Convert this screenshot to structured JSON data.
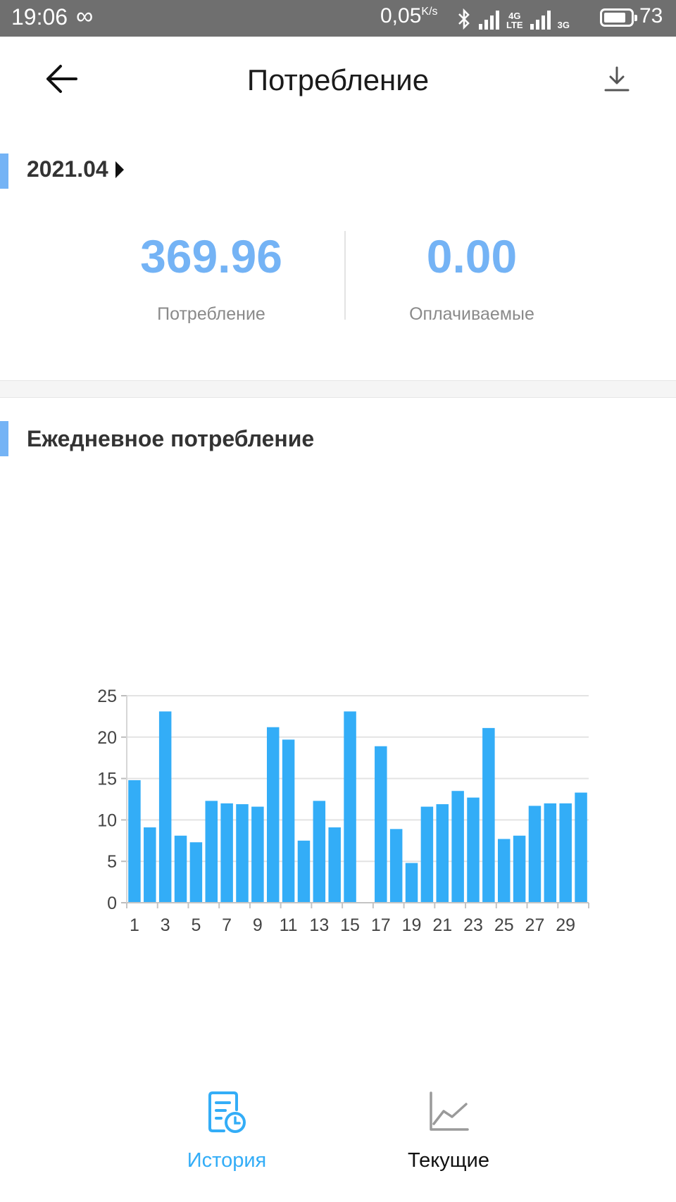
{
  "status_bar": {
    "time": "19:06",
    "speed": "0,05",
    "speed_unit": "K/s",
    "network_1": "4G",
    "network_1_sub": "LTE",
    "network_2": "3G",
    "battery": "73"
  },
  "header": {
    "title": "Потребление"
  },
  "summary": {
    "period": "2021.04",
    "consumption_value": "369.96",
    "consumption_label": "Потребление",
    "payable_value": "0.00",
    "payable_label": "Оплачиваемые"
  },
  "daily": {
    "title": "Ежедневное потребление"
  },
  "chart_data": {
    "type": "bar",
    "categories": [
      "1",
      "2",
      "3",
      "4",
      "5",
      "6",
      "7",
      "8",
      "9",
      "10",
      "11",
      "12",
      "13",
      "14",
      "15",
      "16",
      "17",
      "18",
      "19",
      "20",
      "21",
      "22",
      "23",
      "24",
      "25",
      "26",
      "27",
      "28",
      "29",
      "30"
    ],
    "x_tick_labels": [
      "1",
      "3",
      "5",
      "7",
      "9",
      "11",
      "13",
      "15",
      "17",
      "19",
      "21",
      "23",
      "25",
      "27",
      "29"
    ],
    "values": [
      14.8,
      9.1,
      23.1,
      8.1,
      7.3,
      12.3,
      12.0,
      11.9,
      11.6,
      21.2,
      19.7,
      7.5,
      12.3,
      9.1,
      23.1,
      0,
      18.9,
      8.9,
      4.8,
      11.6,
      11.9,
      13.5,
      12.7,
      21.1,
      7.7,
      8.1,
      11.7,
      12.0,
      12.0,
      13.3
    ],
    "ylim": [
      0,
      25
    ],
    "yticks": [
      0,
      5,
      10,
      15,
      20,
      25
    ],
    "grid": true,
    "bar_color": "#33adf7"
  },
  "nav": {
    "history_label": "История",
    "current_label": "Текущие",
    "active_color": "#33adf7"
  }
}
